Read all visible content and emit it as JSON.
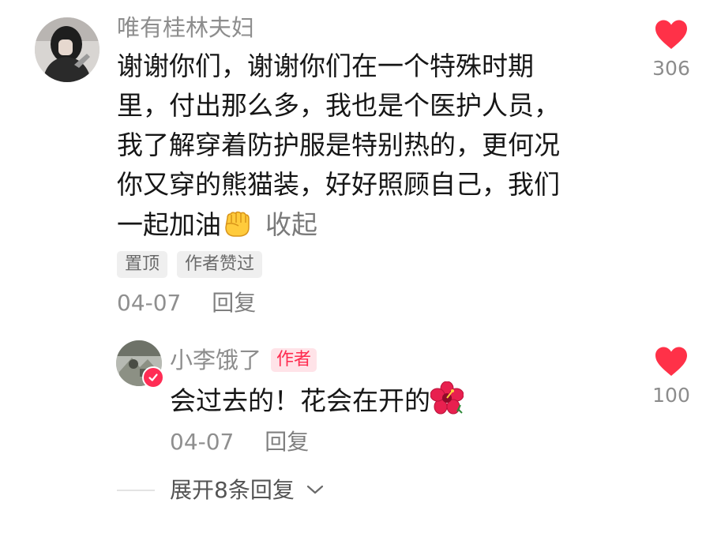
{
  "comment": {
    "username": "唯有桂林夫妇",
    "text_lines": [
      "谢谢你们，谢谢你们在一个特殊时期",
      "里，付出那么多，我也是个医护人员，",
      "我了解穿着防护服是特别热的，更何况",
      "你又穿的熊猫装，好好照顾自己，我们",
      "一起加油"
    ],
    "fist_emoji": "✊",
    "collapse_label": "收起",
    "tags": [
      "置顶",
      "作者赞过"
    ],
    "date": "04-07",
    "reply_label": "回复",
    "like_count": "306",
    "like_icon": "heart-icon"
  },
  "reply": {
    "username": "小李饿了",
    "author_badge": "作者",
    "text": "会过去的！花会在开的",
    "flower_emoji": "🌺",
    "date": "04-07",
    "reply_label": "回复",
    "like_count": "100",
    "like_icon": "heart-icon"
  },
  "expand_label": "展开8条回复",
  "colors": {
    "heart": "#ff3148",
    "badge": "#ff2b4f",
    "badge_bg": "#ffe3e8",
    "meta": "#8f8f8f"
  }
}
